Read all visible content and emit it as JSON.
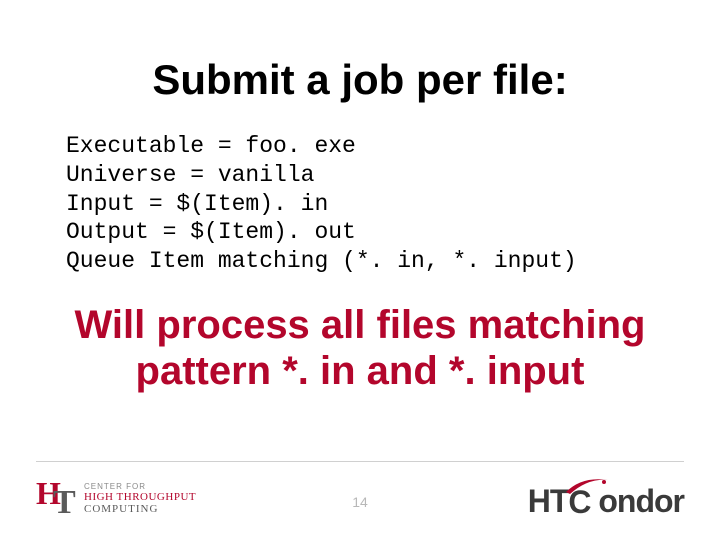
{
  "title": "Submit a job per file:",
  "code": "Executable = foo. exe\nUniverse = vanilla\nInput = $(Item). in\nOutput = $(Item). out\nQueue Item matching (*. in, *. input)",
  "matching_line1": "Will process all files matching",
  "matching_line2": "pattern *. in and *. input",
  "page_number": "14",
  "left_logo": {
    "line1": "CENTER FOR",
    "line2": "HIGH THROUGHPUT",
    "line3": "COMPUTING"
  },
  "right_logo": {
    "part1": "HT",
    "c": "C",
    "part2": "ondor"
  }
}
